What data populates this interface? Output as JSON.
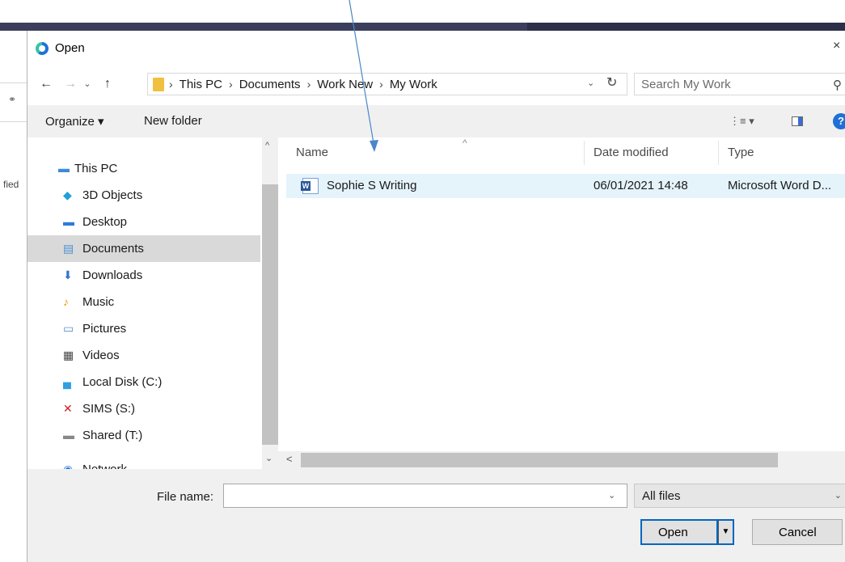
{
  "dialog": {
    "title": "Open",
    "close_glyph": "×"
  },
  "background": {
    "side_text": "fied"
  },
  "nav": {
    "back": "←",
    "forward": "→",
    "recent": "⌄",
    "up": "↑",
    "breadcrumbs": [
      "This PC",
      "Documents",
      "Work New",
      "My Work"
    ],
    "breadcrumb_separator": "›",
    "search_placeholder": "Search My Work"
  },
  "toolbar": {
    "organize_label": "Organize ▾",
    "new_folder_label": "New folder",
    "views_label": "⋮≡ ▾",
    "help_label": "?"
  },
  "sidebar": {
    "items": [
      {
        "label": "This PC",
        "icon": "computer-icon",
        "color": "#3d8bd8",
        "selected": false
      },
      {
        "label": "3D Objects",
        "icon": "cube-icon",
        "color": "#1fa0d8",
        "selected": false
      },
      {
        "label": "Desktop",
        "icon": "desktop-icon",
        "color": "#2e7bd6",
        "selected": false
      },
      {
        "label": "Documents",
        "icon": "documents-icon",
        "color": "#4a8fd0",
        "selected": true
      },
      {
        "label": "Downloads",
        "icon": "downloads-icon",
        "color": "#2f74d0",
        "selected": false
      },
      {
        "label": "Music",
        "icon": "music-icon",
        "color": "#e0a000",
        "selected": false
      },
      {
        "label": "Pictures",
        "icon": "pictures-icon",
        "color": "#5a8fc8",
        "selected": false
      },
      {
        "label": "Videos",
        "icon": "videos-icon",
        "color": "#444444",
        "selected": false
      },
      {
        "label": "Local Disk (C:)",
        "icon": "disk-icon",
        "color": "#2fa0e0",
        "selected": false
      },
      {
        "label": "SIMS (S:)",
        "icon": "network-drive-disconnected-icon",
        "color": "#d02020",
        "selected": false
      },
      {
        "label": "Shared (T:)",
        "icon": "network-drive-icon",
        "color": "#888888",
        "selected": false
      },
      {
        "label": "Network",
        "icon": "network-icon",
        "color": "#2e7bd6",
        "selected": false
      }
    ]
  },
  "filelist": {
    "columns": [
      "Name",
      "Date modified",
      "Type"
    ],
    "sort_glyph": "^",
    "files": [
      {
        "name": "Sophie S Writing",
        "date": "06/01/2021 14:48",
        "type": "Microsoft Word D...",
        "icon": "word-document-icon"
      }
    ],
    "scroll_left": "<"
  },
  "bottom": {
    "file_name_label": "File name:",
    "file_name_value": "",
    "file_type": "All files",
    "open_label": "Open",
    "cancel_label": "Cancel"
  },
  "colors": {
    "accent": "#0067c0",
    "selected_row": "#e5f3fb",
    "annotation_arrow": "#4a86c8"
  }
}
